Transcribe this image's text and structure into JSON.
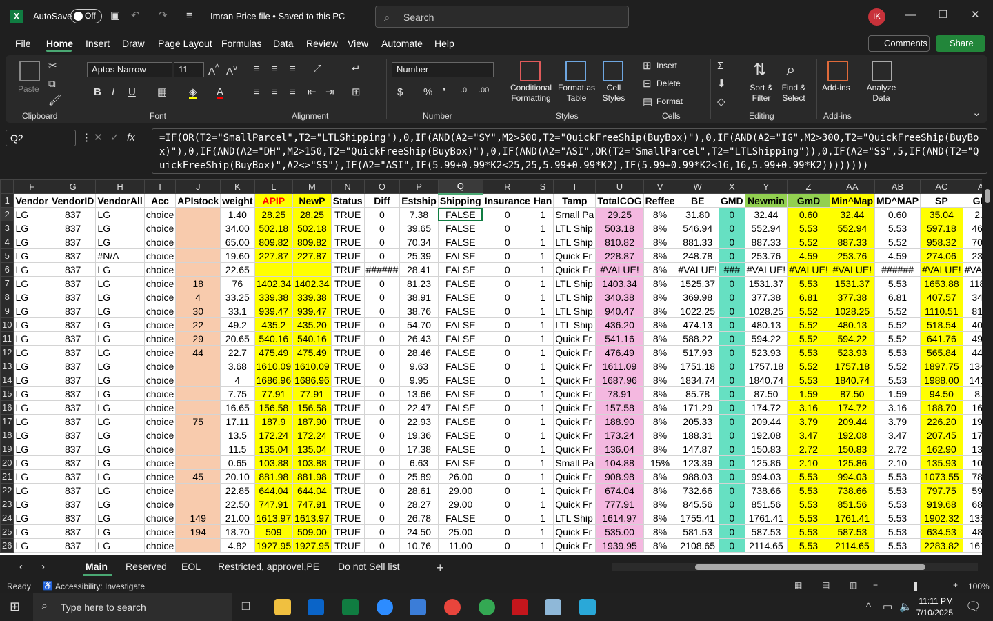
{
  "app": {
    "autosave_label": "AutoSave",
    "autosave_state": "Off",
    "doc_title": "Imran Price file • Saved to this PC",
    "search_placeholder": "Search",
    "avatar": "IK"
  },
  "menu": [
    "File",
    "Home",
    "Insert",
    "Draw",
    "Page Layout",
    "Formulas",
    "Data",
    "Review",
    "View",
    "Automate",
    "Help"
  ],
  "menu_right": {
    "comments": "Comments",
    "share": "Share"
  },
  "ribbon": {
    "clipboard": {
      "label": "Clipboard",
      "paste": "Paste"
    },
    "font": {
      "label": "Font",
      "family": "Aptos Narrow",
      "size": "11"
    },
    "alignment": {
      "label": "Alignment"
    },
    "number": {
      "label": "Number",
      "format": "Number"
    },
    "styles": {
      "label": "Styles",
      "conditional": "Conditional Formatting",
      "format_table": "Format as Table",
      "cell_styles": "Cell Styles"
    },
    "cells": {
      "label": "Cells",
      "insert": "Insert",
      "delete": "Delete",
      "format": "Format"
    },
    "editing": {
      "label": "Editing",
      "sort": "Sort & Filter",
      "find": "Find & Select"
    },
    "addins": {
      "label": "Add-ins",
      "addins": "Add-ins",
      "analyze": "Analyze Data"
    }
  },
  "formula_bar": {
    "namebox": "Q2",
    "formula": "=IF(OR(T2=\"SmallParcel\",T2=\"LTLShipping\"),0,IF(AND(A2=\"SY\",M2>500,T2=\"QuickFreeShip(BuyBox)\"),0,IF(AND(A2=\"IG\",M2>300,T2=\"QuickFreeShip(BuyBox)\"),0,IF(AND(A2=\"DH\",M2>150,T2=\"QuickFreeShip(BuyBox)\"),0,IF(AND(A2=\"ASI\",OR(T2=\"SmallParcel\",T2=\"LTLShipping\")),0,IF(A2=\"SS\",5,IF(AND(T2=\"QuickFreeShip(BuyBox)\",A2<>\"SS\"),IF(A2=\"ASI\",IF(5.99+0.99*K2<25,25,5.99+0.99*K2),IF(5.99+0.99*K2<16,16,5.99+0.99*K2))))))))"
  },
  "columns": [
    "F",
    "G",
    "H",
    "I",
    "J",
    "K",
    "L",
    "M",
    "N",
    "O",
    "P",
    "Q",
    "R",
    "S",
    "T",
    "U",
    "V",
    "W",
    "X",
    "Y",
    "Z",
    "AA",
    "AB",
    "AC",
    "AD",
    "AE",
    "AF"
  ],
  "headers": [
    "Vendor",
    "VendorID",
    "VendorAll",
    "Acc",
    "APIstock",
    "weight",
    "APIP",
    "NewP",
    "Status",
    "Diff",
    "Estship",
    "Shipping",
    "Insurance",
    "Han",
    "Tamp",
    "TotalCOG",
    "Reffee",
    "BE",
    "GMD",
    "Newmin",
    "GmD",
    "Min^Map",
    "MD^MAP",
    "SP",
    "GMD",
    "BusinessP",
    "M"
  ],
  "rows": [
    [
      "2",
      "LG",
      "837",
      "LG",
      "choice",
      "",
      "1.40",
      "28.25",
      "28.25",
      "TRUE",
      "0",
      "7.38",
      "FALSE",
      "0",
      "1",
      "Small Pa",
      "29.25",
      "8%",
      "31.80",
      "0",
      "32.44",
      "0.60",
      "32.44",
      "0.60",
      "35.04",
      "2.99",
      "35.04",
      "5"
    ],
    [
      "3",
      "LG",
      "837",
      "LG",
      "choice",
      "",
      "34.00",
      "502.18",
      "502.18",
      "TRUE",
      "0",
      "39.65",
      "FALSE",
      "0",
      "1",
      "LTL Ship",
      "503.18",
      "8%",
      "546.94",
      "0",
      "552.94",
      "5.53",
      "552.94",
      "5.53",
      "597.18",
      "46.22",
      "597.18",
      "9"
    ],
    [
      "4",
      "LG",
      "837",
      "LG",
      "choice",
      "",
      "65.00",
      "809.82",
      "809.82",
      "TRUE",
      "0",
      "70.34",
      "FALSE",
      "0",
      "1",
      "LTL Ship",
      "810.82",
      "8%",
      "881.33",
      "0",
      "887.33",
      "5.52",
      "887.33",
      "5.52",
      "958.32",
      "70.83",
      "958.32",
      "15"
    ],
    [
      "5",
      "LG",
      "837",
      "#N/A",
      "choice",
      "",
      "19.60",
      "227.87",
      "227.87",
      "TRUE",
      "0",
      "25.39",
      "FALSE",
      "0",
      "1",
      "Quick Fr",
      "228.87",
      "8%",
      "248.78",
      "0",
      "253.76",
      "4.59",
      "253.76",
      "4.59",
      "274.06",
      "23.27",
      "274.06",
      "4"
    ],
    [
      "6",
      "LG",
      "837",
      "LG",
      "choice",
      "",
      "22.65",
      "",
      "",
      "TRUE",
      "######",
      "28.41",
      "FALSE",
      "0",
      "1",
      "Quick Fr",
      "#VALUE!",
      "8%",
      "#VALUE!",
      "###",
      "#VALUE!",
      "#VALUE!",
      "#VALUE!",
      "######",
      "#VALUE!",
      "#VALUE!",
      "#VALUE!",
      "#V"
    ],
    [
      "7",
      "LG",
      "837",
      "LG",
      "choice",
      "18",
      "76",
      "1402.34",
      "1402.34",
      "TRUE",
      "0",
      "81.23",
      "FALSE",
      "0",
      "1",
      "LTL Ship",
      "1403.34",
      "8%",
      "1525.37",
      "0",
      "1531.37",
      "5.53",
      "1531.37",
      "5.53",
      "1653.88",
      "118.24",
      "1653.88",
      "27"
    ],
    [
      "8",
      "LG",
      "837",
      "LG",
      "choice",
      "4",
      "33.25",
      "339.38",
      "339.38",
      "TRUE",
      "0",
      "38.91",
      "FALSE",
      "0",
      "1",
      "LTL Ship",
      "340.38",
      "8%",
      "369.98",
      "0",
      "377.38",
      "6.81",
      "377.38",
      "6.81",
      "407.57",
      "34.59",
      "407.57",
      "6"
    ],
    [
      "9",
      "LG",
      "837",
      "LG",
      "choice",
      "30",
      "33.1",
      "939.47",
      "939.47",
      "TRUE",
      "0",
      "38.76",
      "FALSE",
      "0",
      "1",
      "LTL Ship",
      "940.47",
      "8%",
      "1022.25",
      "0",
      "1028.25",
      "5.52",
      "1028.25",
      "5.52",
      "1110.51",
      "81.20",
      "1110.51",
      "18"
    ],
    [
      "10",
      "LG",
      "837",
      "LG",
      "choice",
      "22",
      "49.2",
      "435.2",
      "435.20",
      "TRUE",
      "0",
      "54.70",
      "FALSE",
      "0",
      "1",
      "LTL Ship",
      "436.20",
      "8%",
      "474.13",
      "0",
      "480.13",
      "5.52",
      "480.13",
      "5.52",
      "518.54",
      "40.86",
      "518.54",
      "8"
    ],
    [
      "11",
      "LG",
      "837",
      "LG",
      "choice",
      "29",
      "20.65",
      "540.16",
      "540.16",
      "TRUE",
      "0",
      "26.43",
      "FALSE",
      "0",
      "1",
      "Quick Fr",
      "541.16",
      "8%",
      "588.22",
      "0",
      "594.22",
      "5.52",
      "594.22",
      "5.52",
      "641.76",
      "49.26",
      "641.76",
      "10"
    ],
    [
      "12",
      "LG",
      "837",
      "LG",
      "choice",
      "44",
      "22.7",
      "475.49",
      "475.49",
      "TRUE",
      "0",
      "28.46",
      "FALSE",
      "0",
      "1",
      "Quick Fr",
      "476.49",
      "8%",
      "517.93",
      "0",
      "523.93",
      "5.53",
      "523.93",
      "5.53",
      "565.84",
      "44.09",
      "565.84",
      "9"
    ],
    [
      "13",
      "LG",
      "837",
      "LG",
      "choice",
      "",
      "3.68",
      "1610.09",
      "1610.09",
      "TRUE",
      "0",
      "9.63",
      "FALSE",
      "0",
      "1",
      "Quick Fr",
      "1611.09",
      "8%",
      "1751.18",
      "0",
      "1757.18",
      "5.52",
      "1757.18",
      "5.52",
      "1897.75",
      "134.85",
      "1897.75",
      "31"
    ],
    [
      "14",
      "LG",
      "837",
      "LG",
      "choice",
      "",
      "4",
      "1686.96",
      "1686.96",
      "TRUE",
      "0",
      "9.95",
      "FALSE",
      "0",
      "1",
      "Quick Fr",
      "1687.96",
      "8%",
      "1834.74",
      "0",
      "1840.74",
      "5.53",
      "1840.74",
      "5.53",
      "1988.00",
      "141.01",
      "1988.00",
      "33"
    ],
    [
      "15",
      "LG",
      "837",
      "LG",
      "choice",
      "",
      "7.75",
      "77.91",
      "77.91",
      "TRUE",
      "0",
      "13.66",
      "FALSE",
      "0",
      "1",
      "Quick Fr",
      "78.91",
      "8%",
      "85.78",
      "0",
      "87.50",
      "1.59",
      "87.50",
      "1.59",
      "94.50",
      "8.03",
      "94.50",
      "1"
    ],
    [
      "16",
      "LG",
      "837",
      "LG",
      "choice",
      "",
      "16.65",
      "156.58",
      "156.58",
      "TRUE",
      "0",
      "22.47",
      "FALSE",
      "0",
      "1",
      "Quick Fr",
      "157.58",
      "8%",
      "171.29",
      "0",
      "174.72",
      "3.16",
      "174.72",
      "3.16",
      "188.70",
      "16.02",
      "188.70",
      "3"
    ],
    [
      "17",
      "LG",
      "837",
      "LG",
      "choice",
      "75",
      "17.11",
      "187.9",
      "187.90",
      "TRUE",
      "0",
      "22.93",
      "FALSE",
      "0",
      "1",
      "Quick Fr",
      "188.90",
      "8%",
      "205.33",
      "0",
      "209.44",
      "3.79",
      "209.44",
      "3.79",
      "226.20",
      "19.20",
      "226.20",
      "37"
    ],
    [
      "18",
      "LG",
      "837",
      "LG",
      "choice",
      "",
      "13.5",
      "172.24",
      "172.24",
      "TRUE",
      "0",
      "19.36",
      "FALSE",
      "0",
      "1",
      "Quick Fr",
      "173.24",
      "8%",
      "188.31",
      "0",
      "192.08",
      "3.47",
      "192.08",
      "3.47",
      "207.45",
      "17.61",
      "207.45",
      "34"
    ],
    [
      "19",
      "LG",
      "837",
      "LG",
      "choice",
      "",
      "11.5",
      "135.04",
      "135.04",
      "TRUE",
      "0",
      "17.38",
      "FALSE",
      "0",
      "1",
      "Quick Fr",
      "136.04",
      "8%",
      "147.87",
      "0",
      "150.83",
      "2.72",
      "150.83",
      "2.72",
      "162.90",
      "13.83",
      "162.90",
      "27"
    ],
    [
      "20",
      "LG",
      "837",
      "LG",
      "choice",
      "",
      "0.65",
      "103.88",
      "103.88",
      "TRUE",
      "0",
      "6.63",
      "FALSE",
      "0",
      "1",
      "Small Pa",
      "104.88",
      "15%",
      "123.39",
      "0",
      "125.86",
      "2.10",
      "125.86",
      "2.10",
      "135.93",
      "10.66",
      "135.93",
      "22"
    ],
    [
      "21",
      "LG",
      "837",
      "LG",
      "choice",
      "45",
      "20.10",
      "881.98",
      "881.98",
      "TRUE",
      "0",
      "25.89",
      "26.00",
      "0",
      "1",
      "Quick Fr",
      "908.98",
      "8%",
      "988.03",
      "0",
      "994.03",
      "5.53",
      "994.03",
      "5.53",
      "1073.55",
      "78.69",
      "1073.55",
      "17"
    ],
    [
      "22",
      "LG",
      "837",
      "LG",
      "choice",
      "",
      "22.85",
      "644.04",
      "644.04",
      "TRUE",
      "0",
      "28.61",
      "29.00",
      "0",
      "1",
      "Quick Fr",
      "674.04",
      "8%",
      "732.66",
      "0",
      "738.66",
      "5.53",
      "738.66",
      "5.53",
      "797.75",
      "59.89",
      "797.75",
      "13"
    ],
    [
      "23",
      "LG",
      "837",
      "LG",
      "choice",
      "",
      "22.50",
      "747.91",
      "747.91",
      "TRUE",
      "0",
      "28.27",
      "29.00",
      "0",
      "1",
      "Quick Fr",
      "777.91",
      "8%",
      "845.56",
      "0",
      "851.56",
      "5.53",
      "851.56",
      "5.53",
      "919.68",
      "68.20",
      "919.68",
      "15"
    ],
    [
      "24",
      "LG",
      "837",
      "LG",
      "choice",
      "149",
      "21.00",
      "1613.97",
      "1613.97",
      "TRUE",
      "0",
      "26.78",
      "FALSE",
      "0",
      "1",
      "LTL Ship",
      "1614.97",
      "8%",
      "1755.41",
      "0",
      "1761.41",
      "5.53",
      "1761.41",
      "5.53",
      "1902.32",
      "135.17",
      "1902.32",
      "31"
    ],
    [
      "25",
      "LG",
      "837",
      "LG",
      "choice",
      "194",
      "18.70",
      "509",
      "509.00",
      "TRUE",
      "0",
      "24.50",
      "25.00",
      "0",
      "1",
      "Quick Fr",
      "535.00",
      "8%",
      "581.53",
      "0",
      "587.53",
      "5.53",
      "587.53",
      "5.53",
      "634.53",
      "48.77",
      "634.53",
      "10"
    ],
    [
      "26",
      "LG",
      "837",
      "LG",
      "choice",
      "",
      "4.82",
      "1927.95",
      "1927.95",
      "TRUE",
      "0",
      "10.76",
      "11.00",
      "0",
      "1",
      "Quick Fr",
      "1939.95",
      "8%",
      "2108.65",
      "0",
      "2114.65",
      "5.53",
      "2114.65",
      "5.53",
      "2283.82",
      "161.17",
      "2283.82",
      "38"
    ]
  ],
  "sheets": [
    "Main",
    "Reserved",
    "EOL",
    "Restricted, approvel,PE",
    "Do not Sell list"
  ],
  "status": {
    "ready": "Ready",
    "accessibility": "Accessibility: Investigate",
    "zoom": "100%"
  },
  "taskbar": {
    "search_placeholder": "Type here to search",
    "time": "11:11 PM",
    "date": "7/10/2025"
  },
  "colors": {
    "yellow": "#ffff00",
    "salmon": "#f8cbad",
    "pink": "#f4b8e0",
    "teal": "#66e0c2",
    "green": "#92d050",
    "accent": "#107c41"
  }
}
